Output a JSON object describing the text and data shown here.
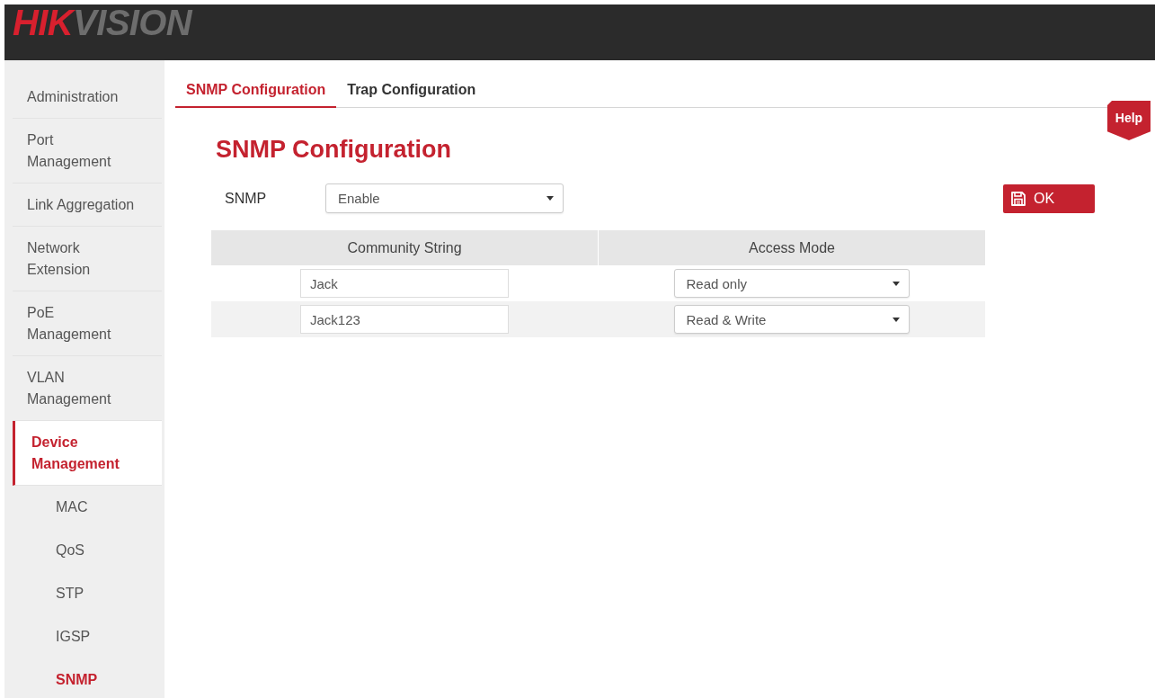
{
  "header": {
    "logo": {
      "lead": "HIK",
      "rest": "VISION"
    }
  },
  "sidebar": {
    "items": [
      {
        "label": "Administration",
        "selected": false
      },
      {
        "label": "Port\nManagement",
        "selected": false
      },
      {
        "label": "Link Aggregation",
        "selected": false
      },
      {
        "label": "Network\nExtension",
        "selected": false
      },
      {
        "label": "PoE\nManagement",
        "selected": false
      },
      {
        "label": "VLAN\nManagement",
        "selected": false
      },
      {
        "label": "Device\nManagement",
        "selected": true,
        "children": [
          {
            "label": "MAC",
            "selected": false
          },
          {
            "label": "QoS",
            "selected": false
          },
          {
            "label": "STP",
            "selected": false
          },
          {
            "label": "IGSP",
            "selected": false
          },
          {
            "label": "SNMP",
            "selected": true
          }
        ]
      }
    ]
  },
  "tabs": [
    {
      "label": "SNMP Configuration",
      "selected": true
    },
    {
      "label": "Trap Configuration",
      "selected": false
    }
  ],
  "help_button": {
    "label": "Help"
  },
  "page_title": "SNMP Configuration",
  "snmp_field": {
    "label": "SNMP",
    "value": "Enable"
  },
  "ok_button": {
    "label": "OK"
  },
  "table": {
    "columns": [
      "Community String",
      "Access Mode"
    ],
    "rows": [
      {
        "community_string": "Jack",
        "access_mode": "Read only"
      },
      {
        "community_string": "Jack123",
        "access_mode": "Read & Write"
      }
    ]
  }
}
